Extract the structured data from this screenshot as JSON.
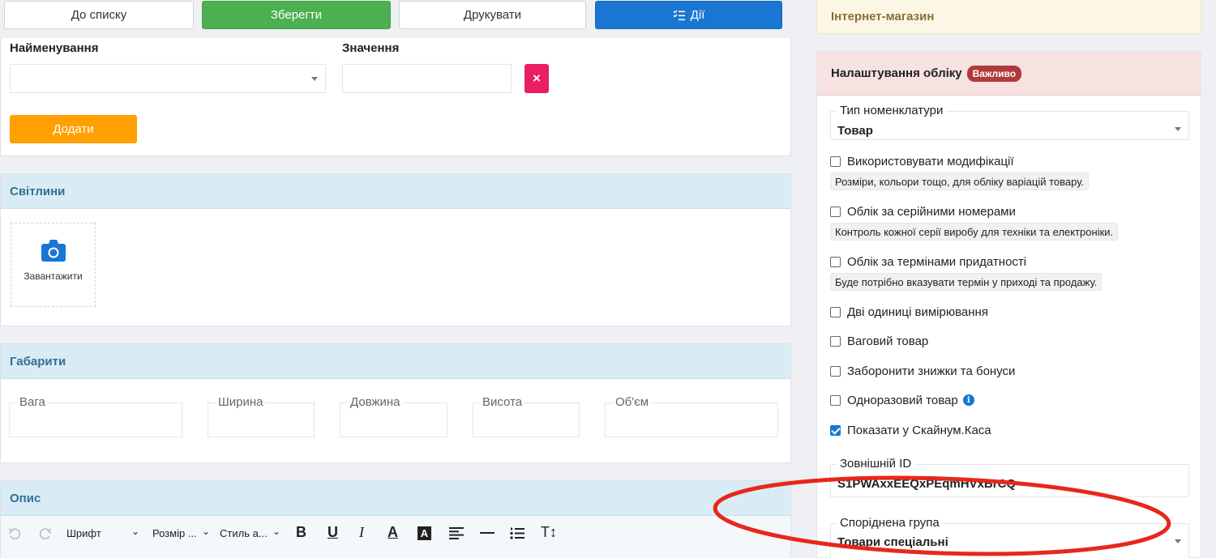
{
  "toolbar": {
    "back_label": "До списку",
    "save_label": "Зберегти",
    "print_label": "Друкувати",
    "actions_label": "Дії"
  },
  "attributes": {
    "name_label": "Найменування",
    "value_label": "Значення",
    "remove_icon": "×",
    "add_label": "Додати"
  },
  "photos": {
    "title": "Світлини",
    "upload_label": "Завантажити"
  },
  "dimensions": {
    "title": "Габарити",
    "fields": [
      "Вага",
      "Ширина",
      "Довжина",
      "Висота",
      "Об'єм"
    ]
  },
  "description": {
    "title": "Опис",
    "toolbar": {
      "font_label": "Шрифт",
      "size_label": "Розмір ...",
      "style_label": "Стиль а..."
    }
  },
  "store_panel": {
    "title": "Інтернет-магазин"
  },
  "accounting": {
    "title": "Налаштування обліку",
    "badge": "Важливо",
    "type_label": "Тип номенклатури",
    "type_value": "Товар",
    "options": [
      {
        "label": "Використовувати модифікації",
        "checked": false,
        "hint": "Розміри, кольори тощо, для обліку варіацій товару."
      },
      {
        "label": "Облік за серійними номерами",
        "checked": false,
        "hint": "Контроль кожної серії виробу для техніки та електроніки."
      },
      {
        "label": "Облік за термінами придатності",
        "checked": false,
        "hint": "Буде потрібно вказувати термін у приході та продажу."
      },
      {
        "label": "Дві одиниці вимірювання",
        "checked": false
      },
      {
        "label": "Ваговий товар",
        "checked": false
      },
      {
        "label": "Заборонити знижки та бонуси",
        "checked": false
      },
      {
        "label": "Одноразовий товар",
        "checked": false
      },
      {
        "label": "Показати у Скайнум.Каса",
        "checked": true
      }
    ],
    "external_id_label": "Зовнішній ID",
    "external_id_value": "S1PWAxxEEQxPEqmHVxBrCQ",
    "related_group_label": "Споріднена група",
    "related_group_value": "Товари спеціальні"
  },
  "colors": {
    "accent": "#1976d2",
    "save": "#4caf50",
    "add": "#ffa000",
    "remove": "#e91e63",
    "annotation": "#e8271b"
  }
}
